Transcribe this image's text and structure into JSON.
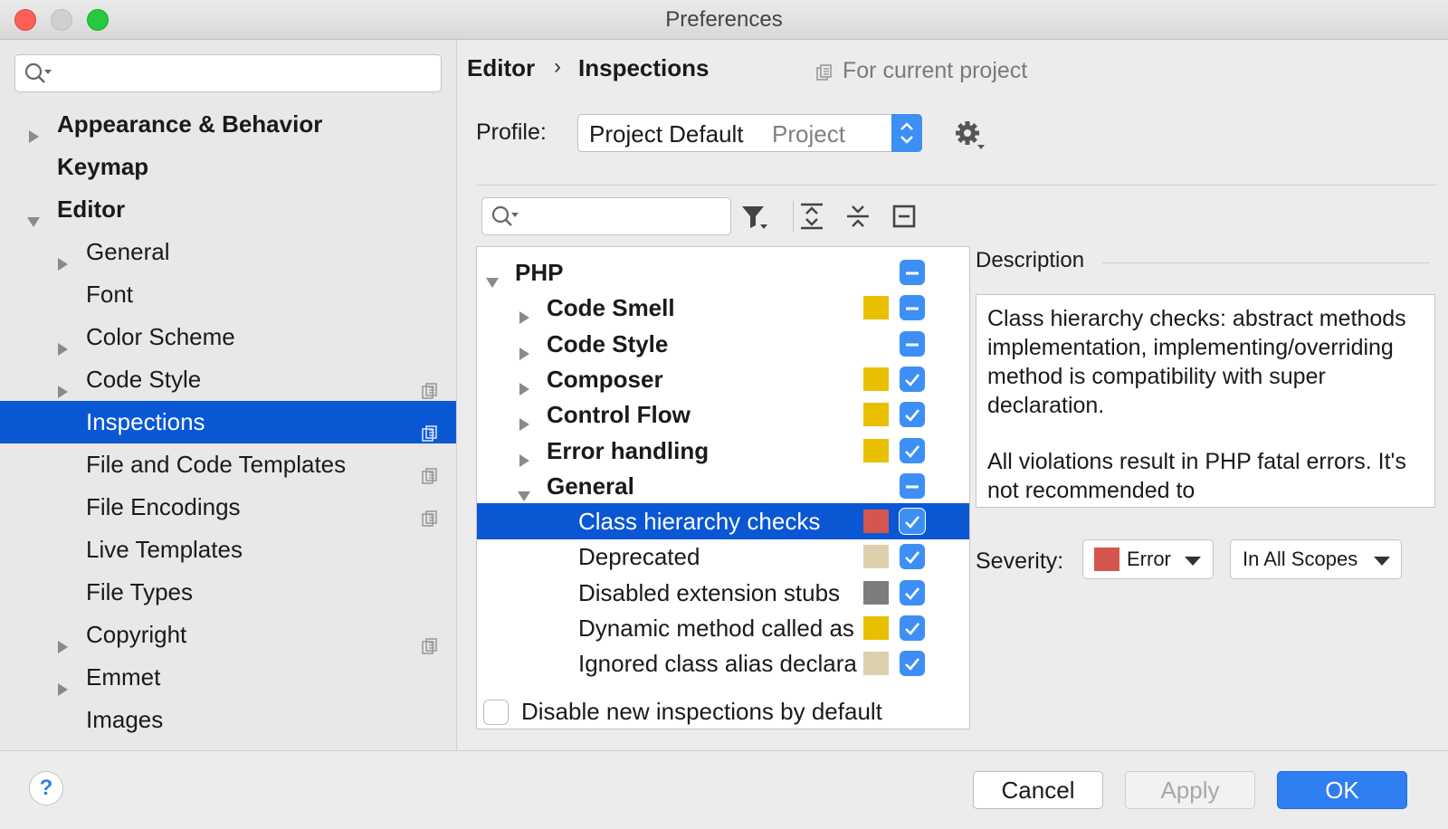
{
  "window": {
    "title": "Preferences"
  },
  "sidebar": {
    "search_placeholder": "",
    "items": [
      {
        "label": "Appearance & Behavior",
        "expandable": true,
        "expanded": false,
        "bold": true,
        "level": 0,
        "project_icon": false
      },
      {
        "label": "Keymap",
        "expandable": false,
        "bold": true,
        "level": 0,
        "project_icon": false
      },
      {
        "label": "Editor",
        "expandable": true,
        "expanded": true,
        "bold": true,
        "level": 0,
        "project_icon": false
      },
      {
        "label": "General",
        "expandable": true,
        "expanded": false,
        "level": 1,
        "project_icon": false
      },
      {
        "label": "Font",
        "expandable": false,
        "level": 1,
        "project_icon": false
      },
      {
        "label": "Color Scheme",
        "expandable": true,
        "expanded": false,
        "level": 1,
        "project_icon": false
      },
      {
        "label": "Code Style",
        "expandable": true,
        "expanded": false,
        "level": 1,
        "project_icon": true
      },
      {
        "label": "Inspections",
        "expandable": false,
        "level": 1,
        "project_icon": true,
        "selected": true
      },
      {
        "label": "File and Code Templates",
        "expandable": false,
        "level": 1,
        "project_icon": true
      },
      {
        "label": "File Encodings",
        "expandable": false,
        "level": 1,
        "project_icon": true
      },
      {
        "label": "Live Templates",
        "expandable": false,
        "level": 1,
        "project_icon": false
      },
      {
        "label": "File Types",
        "expandable": false,
        "level": 1,
        "project_icon": false
      },
      {
        "label": "Copyright",
        "expandable": true,
        "expanded": false,
        "level": 1,
        "project_icon": true
      },
      {
        "label": "Emmet",
        "expandable": true,
        "expanded": false,
        "level": 1,
        "project_icon": false
      },
      {
        "label": "Images",
        "expandable": false,
        "level": 1,
        "project_icon": false
      }
    ]
  },
  "main": {
    "breadcrumb": [
      "Editor",
      "Inspections"
    ],
    "breadcrumb_separator": "›",
    "for_current_project": "For current project",
    "profile": {
      "label": "Profile:",
      "value": "Project Default",
      "scope": "Project"
    },
    "search_placeholder": "",
    "tree": [
      {
        "label": "PHP",
        "level": 0,
        "bold": true,
        "expanded": true,
        "severity_color": null,
        "check": "partial"
      },
      {
        "label": "Code Smell",
        "level": 1,
        "bold": true,
        "expanded": false,
        "severity_color": "#e8c000",
        "check": "partial"
      },
      {
        "label": "Code Style",
        "level": 1,
        "bold": true,
        "expanded": false,
        "severity_color": null,
        "check": "partial"
      },
      {
        "label": "Composer",
        "level": 1,
        "bold": true,
        "expanded": false,
        "severity_color": "#e8c000",
        "check": "checked"
      },
      {
        "label": "Control Flow",
        "level": 1,
        "bold": true,
        "expanded": false,
        "severity_color": "#e8c000",
        "check": "checked"
      },
      {
        "label": "Error handling",
        "level": 1,
        "bold": true,
        "expanded": false,
        "severity_color": "#e8c000",
        "check": "checked"
      },
      {
        "label": "General",
        "level": 1,
        "bold": true,
        "expanded": true,
        "severity_color": null,
        "check": "partial"
      },
      {
        "label": "Class hierarchy checks",
        "level": 2,
        "bold": false,
        "selected": true,
        "severity_color": "#d5564e",
        "check": "checked"
      },
      {
        "label": "Deprecated",
        "level": 2,
        "bold": false,
        "severity_color": "#dcd0ad",
        "check": "checked"
      },
      {
        "label": "Disabled extension stubs",
        "level": 2,
        "bold": false,
        "severity_color": "#7d7d7d",
        "check": "checked"
      },
      {
        "label": "Dynamic method called as",
        "level": 2,
        "bold": false,
        "severity_color": "#e8c000",
        "check": "checked"
      },
      {
        "label": "Ignored class alias declara",
        "level": 2,
        "bold": false,
        "severity_color": "#dcd0ad",
        "check": "checked"
      }
    ],
    "description": {
      "title": "Description",
      "paragraphs": [
        "Class hierarchy checks: abstract methods implementation, implementing/overriding method is compatibility with super declaration.",
        "All violations result in PHP fatal errors. It's not recommended to"
      ]
    },
    "severity": {
      "label": "Severity:",
      "value": "Error",
      "color": "#d5564e",
      "scope_value": "In All Scopes"
    },
    "disable_new": {
      "label": "Disable new inspections by default",
      "checked": false
    }
  },
  "footer": {
    "help": "?",
    "cancel": "Cancel",
    "apply": "Apply",
    "ok": "OK"
  },
  "colors": {
    "selection": "#0a57d4",
    "checkbox": "#3d8ff5",
    "ok_button": "#2f7ef2"
  }
}
